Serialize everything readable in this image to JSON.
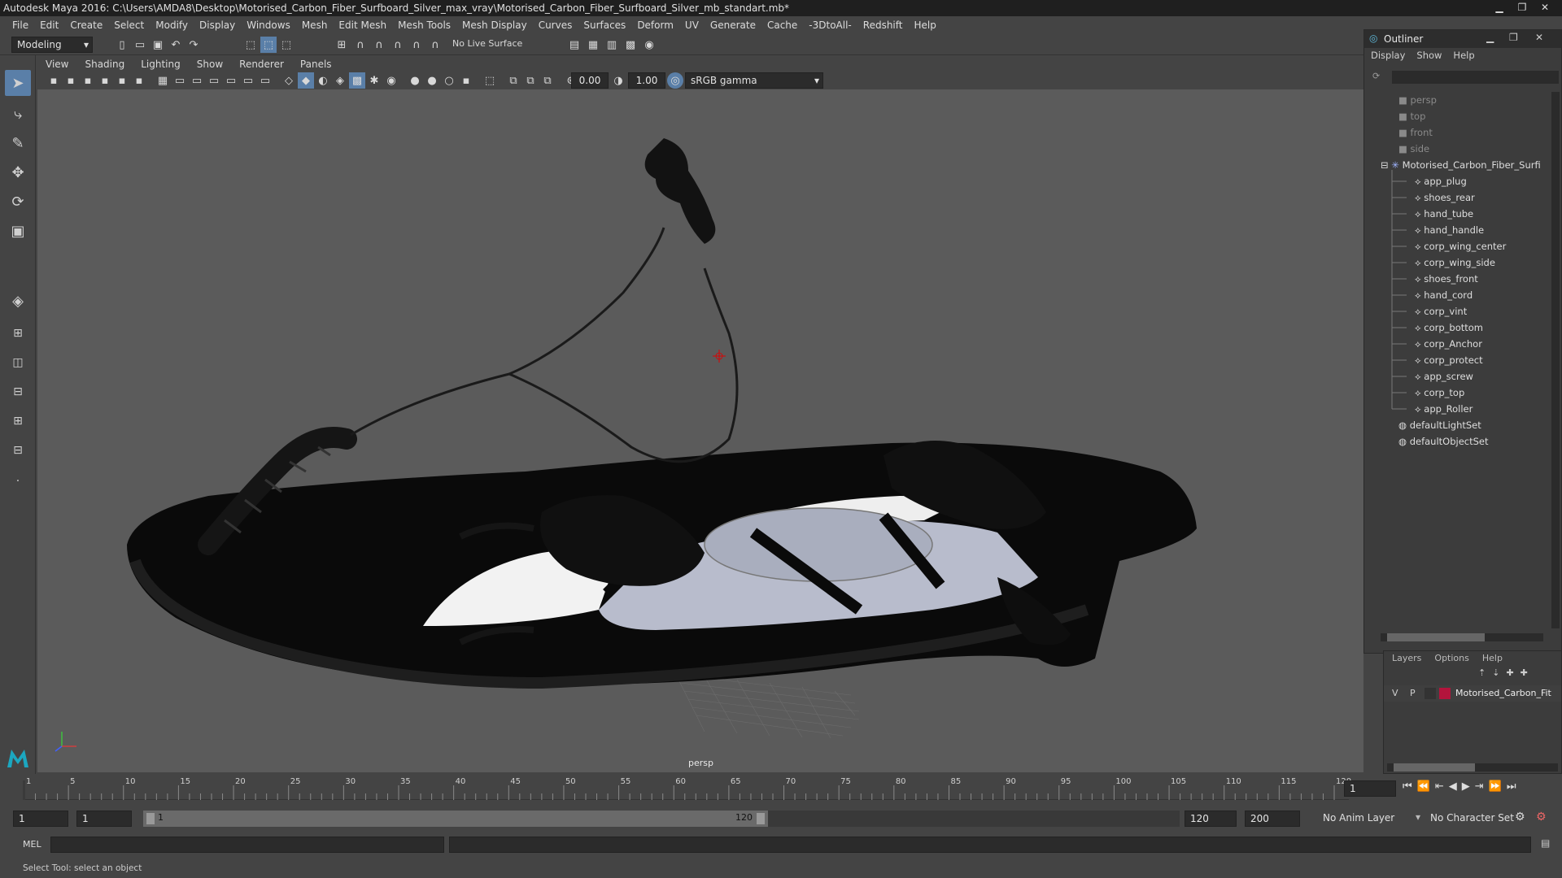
{
  "app": {
    "title": "Autodesk Maya 2016: C:\\Users\\AMDA8\\Desktop\\Motorised_Carbon_Fiber_Surfboard_Silver_max_vray\\Motorised_Carbon_Fiber_Surfboard_Silver_mb_standart.mb*"
  },
  "menubar": [
    "File",
    "Edit",
    "Create",
    "Select",
    "Modify",
    "Display",
    "Windows",
    "Mesh",
    "Edit Mesh",
    "Mesh Tools",
    "Mesh Display",
    "Curves",
    "Surfaces",
    "Deform",
    "UV",
    "Generate",
    "Cache",
    "-3DtoAll-",
    "Redshift",
    "Help"
  ],
  "statusline": {
    "mode": "Modeling",
    "live_surface": "No Live Surface"
  },
  "panel": {
    "menus": [
      "View",
      "Shading",
      "Lighting",
      "Show",
      "Renderer",
      "Panels"
    ],
    "exposure": "0.00",
    "gamma": "1.00",
    "colorspace": "sRGB gamma",
    "camera_label": "persp"
  },
  "outliner": {
    "title": "Outliner",
    "menus": [
      "Display",
      "Show",
      "Help"
    ],
    "cameras": [
      "persp",
      "top",
      "front",
      "side"
    ],
    "group": "Motorised_Carbon_Fiber_Surfi",
    "children": [
      "app_plug",
      "shoes_rear",
      "hand_tube",
      "hand_handle",
      "corp_wing_center",
      "corp_wing_side",
      "shoes_front",
      "hand_cord",
      "corp_vint",
      "corp_bottom",
      "corp_Anchor",
      "corp_protect",
      "app_screw",
      "corp_top",
      "app_Roller"
    ],
    "sets": [
      "defaultLightSet",
      "defaultObjectSet"
    ]
  },
  "layers": {
    "menus": [
      "Layers",
      "Options",
      "Help"
    ],
    "row": {
      "v": "V",
      "p": "P",
      "name": "Motorised_Carbon_Fit",
      "color": "#b3143c"
    }
  },
  "timeline": {
    "ticks": [
      "5",
      "10",
      "15",
      "20",
      "25",
      "30",
      "35",
      "40",
      "45",
      "50",
      "55",
      "60",
      "65",
      "70",
      "75",
      "80",
      "85",
      "90",
      "95",
      "100",
      "105",
      "110",
      "115",
      "120"
    ],
    "start_tick": "1",
    "current_frame": "1"
  },
  "range": {
    "start": "1",
    "anim_start": "1",
    "slider_start": "1",
    "slider_end": "120",
    "anim_end": "120",
    "end": "200",
    "anim_layer": "No Anim Layer",
    "char_set": "No Character Set"
  },
  "cmdline": {
    "label": "MEL"
  },
  "helpline": {
    "text": "Select Tool: select an object"
  },
  "colors": {
    "accent": "#5a7fa8",
    "viewport_bg": "#5b5b5b",
    "board_light": "#b8bccc"
  }
}
